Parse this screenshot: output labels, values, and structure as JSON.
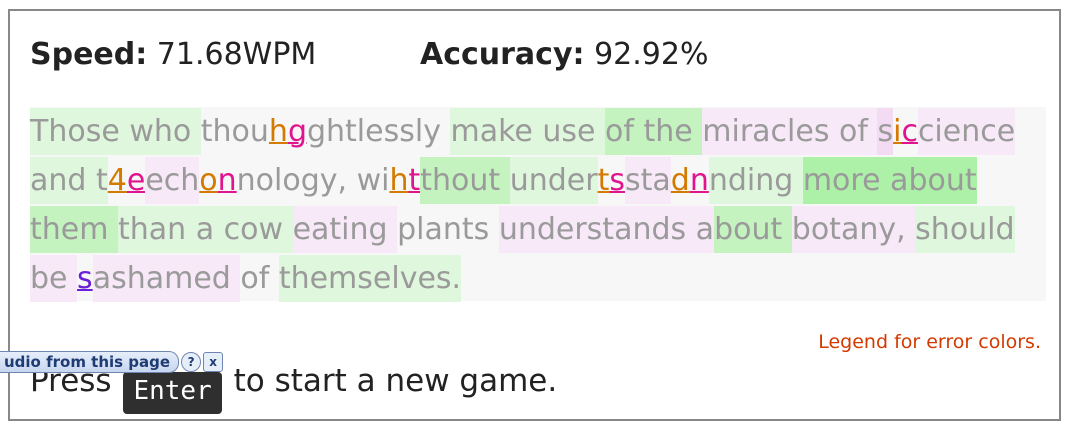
{
  "stats": {
    "speed_label": "Speed:",
    "speed_value": "71.68WPM",
    "accuracy_label": "Accuracy:",
    "accuracy_value": "92.92%"
  },
  "typed_text": {
    "lines": [
      [
        {
          "text": "Those who ",
          "bg": "g1"
        },
        {
          "text": "thou",
          "bg": "none"
        },
        {
          "text": "h",
          "err": "orange"
        },
        {
          "text": "g",
          "err": "mag"
        },
        {
          "text": "ghtlessly ",
          "bg": "none"
        },
        {
          "text": "make use ",
          "bg": "g1"
        },
        {
          "text": "of the ",
          "bg": "g2"
        },
        {
          "text": "miracles of ",
          "bg": "p1"
        },
        {
          "text": "s",
          "bg": "p2"
        },
        {
          "text": "i",
          "err": "orange"
        },
        {
          "text": "c",
          "err": "mag"
        },
        {
          "text": "cience",
          "bg": "p1"
        }
      ],
      [
        {
          "text": "and t",
          "bg": "g1"
        },
        {
          "text": "4",
          "err": "orange"
        },
        {
          "text": "e",
          "err": "mag"
        },
        {
          "text": "ech",
          "bg": "p1"
        },
        {
          "text": "o",
          "err": "orange"
        },
        {
          "text": "n",
          "err": "mag"
        },
        {
          "text": "nology, wi",
          "bg": "none"
        },
        {
          "text": "h",
          "err": "orange"
        },
        {
          "text": "t",
          "err": "mag"
        },
        {
          "text": "thout ",
          "bg": "g2"
        },
        {
          "text": "under",
          "bg": "g1"
        },
        {
          "text": "t",
          "err": "orange"
        },
        {
          "text": "s",
          "err": "mag"
        },
        {
          "text": "sta",
          "bg": "p1"
        },
        {
          "text": "d",
          "err": "orange"
        },
        {
          "text": "n",
          "err": "mag"
        },
        {
          "text": "nding ",
          "bg": "g1"
        },
        {
          "text": "more about",
          "bg": "g3"
        }
      ],
      [
        {
          "text": "them ",
          "bg": "g2"
        },
        {
          "text": "than a cow ",
          "bg": "g1"
        },
        {
          "text": "eating ",
          "bg": "p1"
        },
        {
          "text": "plants ",
          "bg": "none"
        },
        {
          "text": "understands a",
          "bg": "p1"
        },
        {
          "text": "bout ",
          "bg": "g2"
        },
        {
          "text": "botany, ",
          "bg": "p1"
        },
        {
          "text": "should",
          "bg": "g1"
        }
      ],
      [
        {
          "text": "be ",
          "bg": "p1"
        },
        {
          "text": "s",
          "err": "purple"
        },
        {
          "text": "ashamed ",
          "bg": "p1"
        },
        {
          "text": "of ",
          "bg": "none"
        },
        {
          "text": "themselves.",
          "bg": "g1"
        }
      ]
    ]
  },
  "legend_link": "Legend for error colors.",
  "restart": {
    "before": "Press",
    "key": "Enter",
    "after": "to start a new game."
  },
  "audio_overlay": {
    "label": "udio from this page",
    "help_icon": "?",
    "close_icon": "x"
  },
  "colors": {
    "error_orange": "#d37a00",
    "error_magenta": "#e0148e",
    "error_purple": "#6a20d8",
    "legend_link": "#d43a00",
    "key_bg": "#2f2f2f"
  }
}
